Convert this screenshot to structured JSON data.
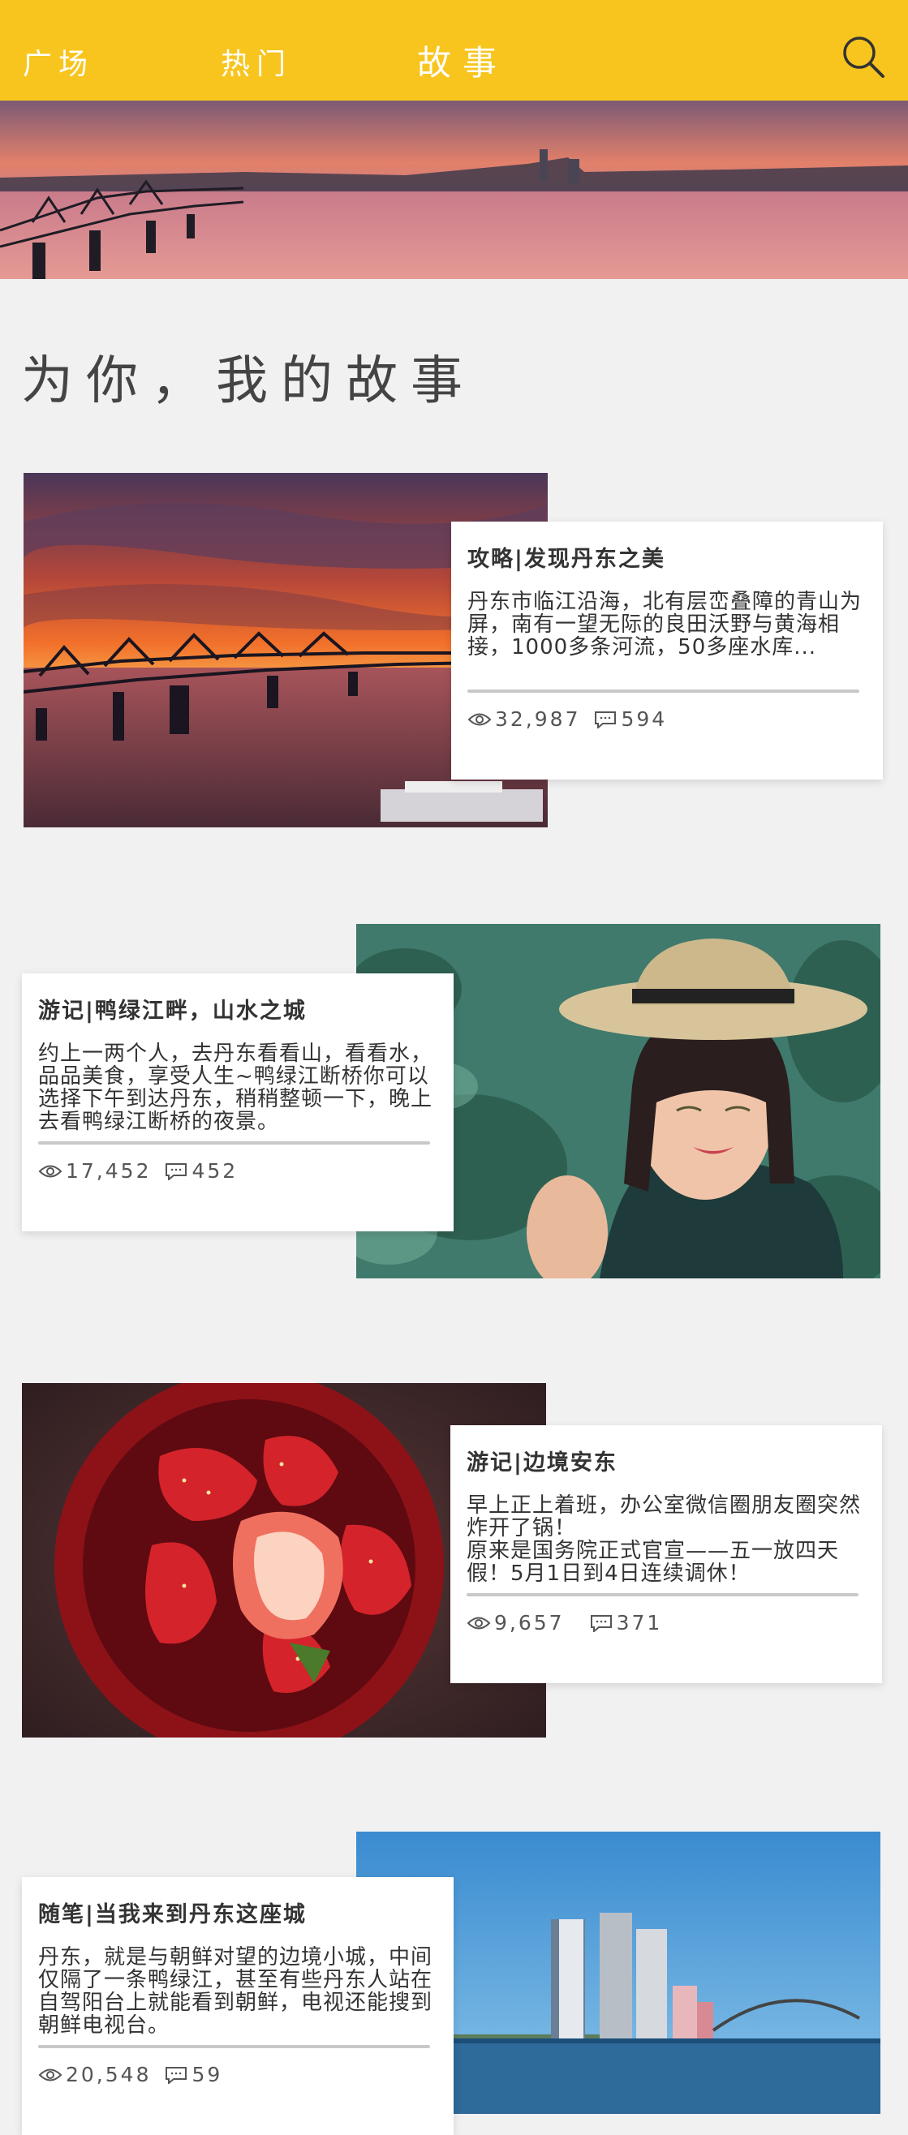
{
  "header": {
    "tabs": [
      {
        "label": "广场"
      },
      {
        "label": "热门"
      },
      {
        "label": "故事",
        "active": true
      }
    ],
    "search_icon": "search-icon",
    "background": "#f8c51e"
  },
  "page_title": "为你，我的故事",
  "stories": [
    {
      "title": "攻略|发现丹东之美",
      "text": "丹东市临江沿海，北有层峦叠障的青山为屏，南有一望无际的良田沃野与黄海相接，1000多条河流，50多座水库...",
      "views": "32,987",
      "comments": "594",
      "image": "sunset-bridge-photo"
    },
    {
      "title": "游记|鸭绿江畔，山水之城",
      "text": "约上一两个人，去丹东看看山，看看水，品品美食，享受人生~鸭绿江断桥你可以选择下午到达丹东，稍稍整顿一下，晚上去看鸭绿江断桥的夜景。",
      "views": "17,452",
      "comments": "452",
      "image": "woman-in-hat-photo"
    },
    {
      "title": "游记|边境安东",
      "text": "早上正上着班，办公室微信圈朋友圈突然炸开了锅！\n原来是国务院正式官宣——五一放四天假！5月1日到4日连续调休！",
      "views": "9,657",
      "comments": "371",
      "image": "strawberries-photo"
    },
    {
      "title": "随笔|当我来到丹东这座城",
      "text": "丹东，就是与朝鲜对望的边境小城，中间仅隔了一条鸭绿江，甚至有些丹东人站在自驾阳台上就能看到朝鲜，电视还能搜到朝鲜电视台。",
      "views": "20,548",
      "comments": "59",
      "image": "riverside-towers-photo"
    }
  ],
  "icons": {
    "views": "eye-icon",
    "comments": "comment-icon"
  }
}
